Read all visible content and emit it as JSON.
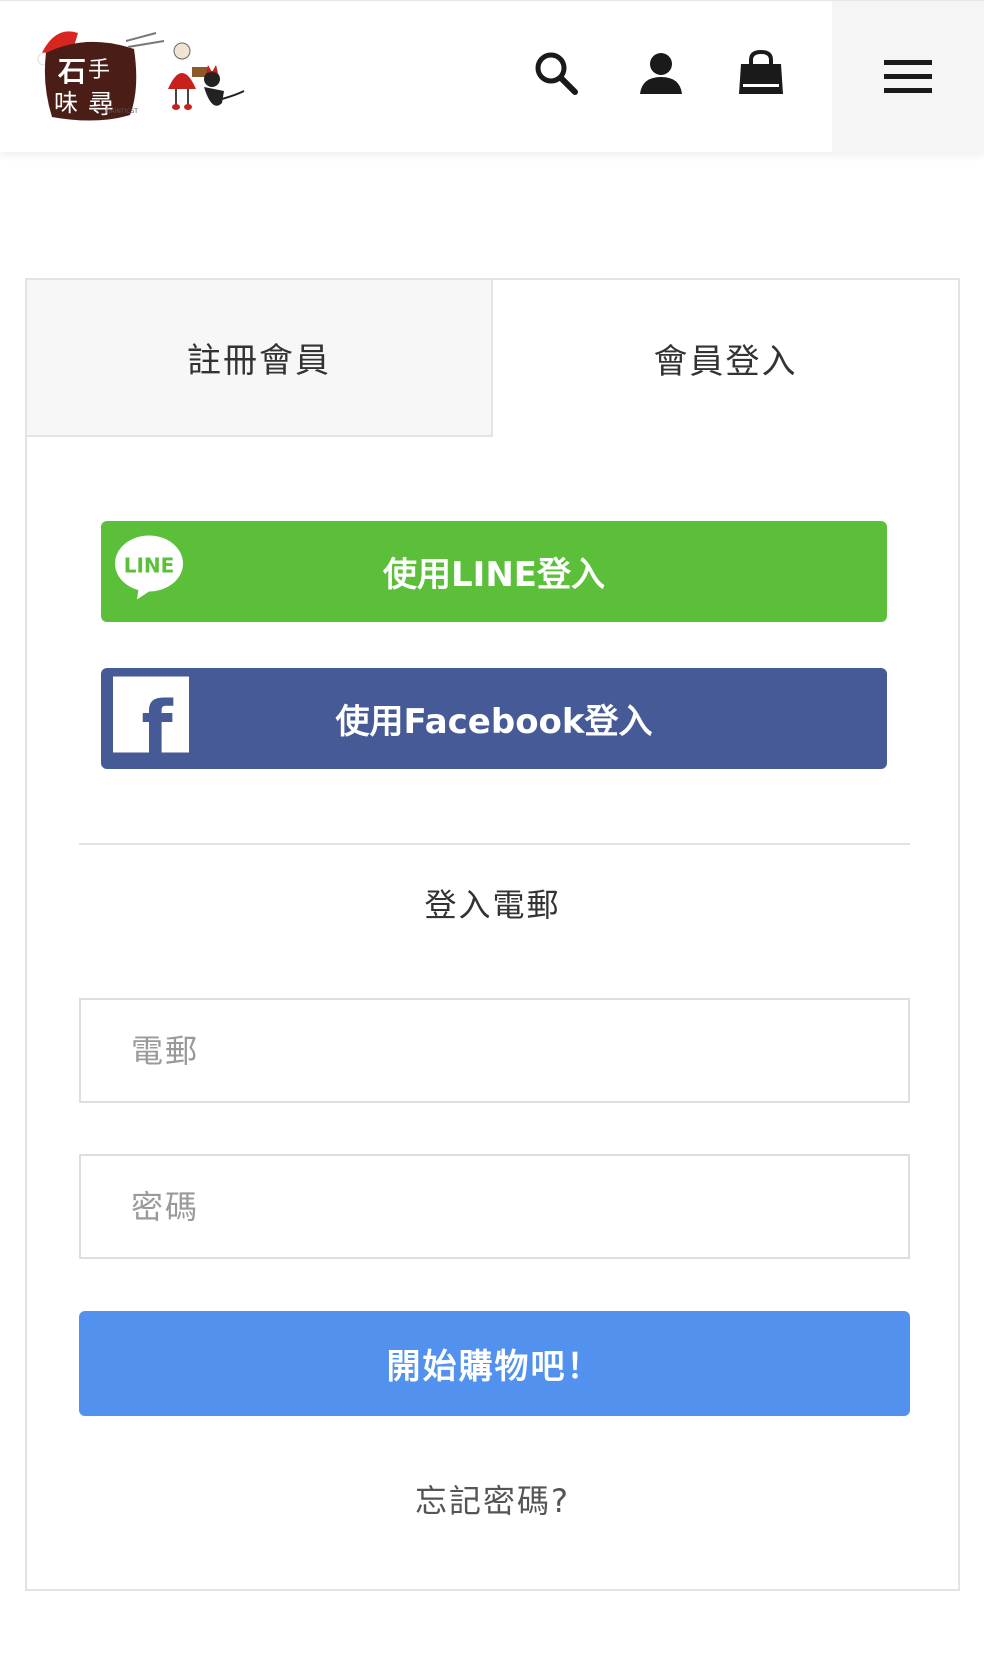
{
  "header": {
    "logo_alt": "logo",
    "search_icon": "search-icon",
    "user_icon": "user-icon",
    "cart_icon": "shopping-bag-icon",
    "menu_icon": "hamburger-menu-icon"
  },
  "tabs": [
    {
      "label": "註冊會員",
      "active": false
    },
    {
      "label": "會員登入",
      "active": true
    }
  ],
  "social": {
    "line_label": "使用LINE登入",
    "line_icon_text": "LINE",
    "facebook_label": "使用Facebook登入",
    "facebook_icon_text": "f"
  },
  "form": {
    "section_title": "登入電郵",
    "email_placeholder": "電郵",
    "email_value": "",
    "password_placeholder": "密碼",
    "password_value": "",
    "submit_label": "開始購物吧！",
    "forgot_label": "忘記密碼?"
  },
  "colors": {
    "line_green": "#5bbf3a",
    "facebook_blue": "#455a96",
    "submit_blue": "#5291ee"
  }
}
